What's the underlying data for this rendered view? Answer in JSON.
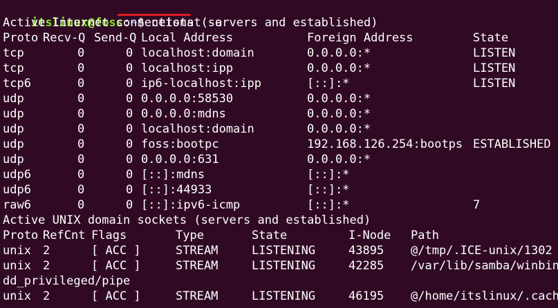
{
  "prompt": {
    "user_host": "itslinux@foss",
    "separator": ":",
    "cwd": "~",
    "symbol": "$ ",
    "command": "netstat -a"
  },
  "inet": {
    "heading": "Active Internet connections (servers and established)",
    "headers": {
      "proto": "Proto",
      "recvq": "Recv-Q",
      "sendq": "Send-Q",
      "local": "Local Address",
      "foreign": "Foreign Address",
      "state": "State"
    },
    "rows": [
      {
        "proto": "tcp",
        "recvq": "0",
        "sendq": "0",
        "local": "localhost:domain",
        "foreign": "0.0.0.0:*",
        "state": "LISTEN"
      },
      {
        "proto": "tcp",
        "recvq": "0",
        "sendq": "0",
        "local": "localhost:ipp",
        "foreign": "0.0.0.0:*",
        "state": "LISTEN"
      },
      {
        "proto": "tcp6",
        "recvq": "0",
        "sendq": "0",
        "local": "ip6-localhost:ipp",
        "foreign": "[::]:*",
        "state": "LISTEN"
      },
      {
        "proto": "udp",
        "recvq": "0",
        "sendq": "0",
        "local": "0.0.0.0:58530",
        "foreign": "0.0.0.0:*",
        "state": ""
      },
      {
        "proto": "udp",
        "recvq": "0",
        "sendq": "0",
        "local": "0.0.0.0:mdns",
        "foreign": "0.0.0.0:*",
        "state": ""
      },
      {
        "proto": "udp",
        "recvq": "0",
        "sendq": "0",
        "local": "localhost:domain",
        "foreign": "0.0.0.0:*",
        "state": ""
      },
      {
        "proto": "udp",
        "recvq": "0",
        "sendq": "0",
        "local": "foss:bootpc",
        "foreign": "192.168.126.254:bootps",
        "state": "ESTABLISHED"
      },
      {
        "proto": "udp",
        "recvq": "0",
        "sendq": "0",
        "local": "0.0.0.0:631",
        "foreign": "0.0.0.0:*",
        "state": ""
      },
      {
        "proto": "udp6",
        "recvq": "0",
        "sendq": "0",
        "local": "[::]:mdns",
        "foreign": "[::]:*",
        "state": ""
      },
      {
        "proto": "udp6",
        "recvq": "0",
        "sendq": "0",
        "local": "[::]:44933",
        "foreign": "[::]:*",
        "state": ""
      },
      {
        "proto": "raw6",
        "recvq": "0",
        "sendq": "0",
        "local": "[::]:ipv6-icmp",
        "foreign": "[::]:*",
        "state": "7"
      }
    ]
  },
  "unix": {
    "heading": "Active UNIX domain sockets (servers and established)",
    "headers": {
      "proto": "Proto",
      "refcnt": "RefCnt",
      "flags": "Flags",
      "type": "Type",
      "state": "State",
      "inode": "I-Node",
      "path": "Path"
    },
    "rows": [
      {
        "proto": "unix",
        "refcnt": "2",
        "flags": "[ ACC ]",
        "type": "STREAM",
        "state": "LISTENING",
        "inode": "43895",
        "path": "@/tmp/.ICE-unix/1302"
      },
      {
        "proto": "unix",
        "refcnt": "2",
        "flags": "[ ACC ]",
        "type": "STREAM",
        "state": "LISTENING",
        "inode": "42285",
        "path": "/var/lib/samba/winbin"
      },
      {
        "proto": "unix",
        "refcnt": "2",
        "flags": "[ ACC ]",
        "type": "STREAM",
        "state": "LISTENING",
        "inode": "46195",
        "path": "@/home/itslinux/.cach"
      }
    ],
    "wrap_continuation": "dd_privileged/pipe"
  },
  "colors": {
    "background": "#300a24",
    "user_host": "#8ae234",
    "cwd": "#729fcf",
    "text": "#ffffff",
    "underline": "#e01b24"
  }
}
